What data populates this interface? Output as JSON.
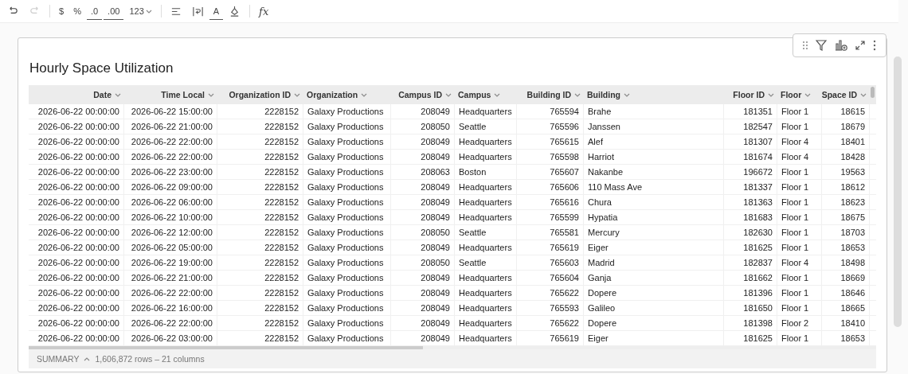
{
  "toolbar": [
    {
      "kind": "undo",
      "disabled": false
    },
    {
      "kind": "redo",
      "disabled": true
    },
    {
      "kind": "sep"
    },
    {
      "kind": "text",
      "label": "$"
    },
    {
      "kind": "text",
      "label": "%"
    },
    {
      "kind": "decimal-less",
      "label": ".0"
    },
    {
      "kind": "decimal-more",
      "label": ".00"
    },
    {
      "kind": "dropdown",
      "label": "123"
    },
    {
      "kind": "sep"
    },
    {
      "kind": "align"
    },
    {
      "kind": "wrap"
    },
    {
      "kind": "text-color",
      "label": "A"
    },
    {
      "kind": "fill"
    },
    {
      "kind": "sep"
    },
    {
      "kind": "formula",
      "label": "fx"
    }
  ],
  "card_toolbar": [
    {
      "kind": "drag"
    },
    {
      "kind": "filter"
    },
    {
      "kind": "chart-add"
    },
    {
      "kind": "expand"
    },
    {
      "kind": "more"
    }
  ],
  "title": "Hourly Space Utilization",
  "table": {
    "columns": [
      {
        "label": "Date"
      },
      {
        "label": "Time Local"
      },
      {
        "label": "Organization ID"
      },
      {
        "label": "Organization"
      },
      {
        "label": "Campus ID"
      },
      {
        "label": "Campus"
      },
      {
        "label": "Building ID"
      },
      {
        "label": "Building"
      },
      {
        "label": "Floor ID"
      },
      {
        "label": "Floor"
      },
      {
        "label": "Space ID"
      }
    ],
    "rows": [
      [
        "2026-06-22 00:00:00",
        "2026-06-22 15:00:00",
        "2228152",
        "Galaxy Productions",
        "208049",
        "Headquarters",
        "765594",
        "Brahe",
        "181351",
        "Floor 1",
        "18615"
      ],
      [
        "2026-06-22 00:00:00",
        "2026-06-22 21:00:00",
        "2228152",
        "Galaxy Productions",
        "208050",
        "Seattle",
        "765596",
        "Janssen",
        "182547",
        "Floor 1",
        "18679"
      ],
      [
        "2026-06-22 00:00:00",
        "2026-06-22 22:00:00",
        "2228152",
        "Galaxy Productions",
        "208049",
        "Headquarters",
        "765615",
        "Alef",
        "181307",
        "Floor 4",
        "18401"
      ],
      [
        "2026-06-22 00:00:00",
        "2026-06-22 22:00:00",
        "2228152",
        "Galaxy Productions",
        "208049",
        "Headquarters",
        "765598",
        "Harriot",
        "181674",
        "Floor 4",
        "18428"
      ],
      [
        "2026-06-22 00:00:00",
        "2026-06-22 23:00:00",
        "2228152",
        "Galaxy Productions",
        "208063",
        "Boston",
        "765607",
        "Nakanbe",
        "196672",
        "Floor 1",
        "19563"
      ],
      [
        "2026-06-22 00:00:00",
        "2026-06-22 09:00:00",
        "2228152",
        "Galaxy Productions",
        "208049",
        "Headquarters",
        "765606",
        "110 Mass Ave",
        "181337",
        "Floor 1",
        "18612"
      ],
      [
        "2026-06-22 00:00:00",
        "2026-06-22 06:00:00",
        "2228152",
        "Galaxy Productions",
        "208049",
        "Headquarters",
        "765616",
        "Chura",
        "181363",
        "Floor 1",
        "18623"
      ],
      [
        "2026-06-22 00:00:00",
        "2026-06-22 10:00:00",
        "2228152",
        "Galaxy Productions",
        "208049",
        "Headquarters",
        "765599",
        "Hypatia",
        "181683",
        "Floor 1",
        "18675"
      ],
      [
        "2026-06-22 00:00:00",
        "2026-06-22 12:00:00",
        "2228152",
        "Galaxy Productions",
        "208050",
        "Seattle",
        "765581",
        "Mercury",
        "182630",
        "Floor 1",
        "18703"
      ],
      [
        "2026-06-22 00:00:00",
        "2026-06-22 05:00:00",
        "2228152",
        "Galaxy Productions",
        "208049",
        "Headquarters",
        "765619",
        "Eiger",
        "181625",
        "Floor 1",
        "18653"
      ],
      [
        "2026-06-22 00:00:00",
        "2026-06-22 19:00:00",
        "2228152",
        "Galaxy Productions",
        "208050",
        "Seattle",
        "765603",
        "Madrid",
        "182837",
        "Floor 4",
        "18498"
      ],
      [
        "2026-06-22 00:00:00",
        "2026-06-22 21:00:00",
        "2228152",
        "Galaxy Productions",
        "208049",
        "Headquarters",
        "765604",
        "Ganja",
        "181662",
        "Floor 1",
        "18669"
      ],
      [
        "2026-06-22 00:00:00",
        "2026-06-22 22:00:00",
        "2228152",
        "Galaxy Productions",
        "208049",
        "Headquarters",
        "765622",
        "Dopere",
        "181396",
        "Floor 1",
        "18646"
      ],
      [
        "2026-06-22 00:00:00",
        "2026-06-22 16:00:00",
        "2228152",
        "Galaxy Productions",
        "208049",
        "Headquarters",
        "765593",
        "Galileo",
        "181650",
        "Floor 1",
        "18665"
      ],
      [
        "2026-06-22 00:00:00",
        "2026-06-22 22:00:00",
        "2228152",
        "Galaxy Productions",
        "208049",
        "Headquarters",
        "765622",
        "Dopere",
        "181398",
        "Floor 2",
        "18410"
      ],
      [
        "2026-06-22 00:00:00",
        "2026-06-22 03:00:00",
        "2228152",
        "Galaxy Productions",
        "208049",
        "Headquarters",
        "765619",
        "Eiger",
        "181625",
        "Floor 1",
        "18653"
      ]
    ]
  },
  "summary": {
    "label": "SUMMARY",
    "text": "1,606,872 rows – 21 columns"
  }
}
